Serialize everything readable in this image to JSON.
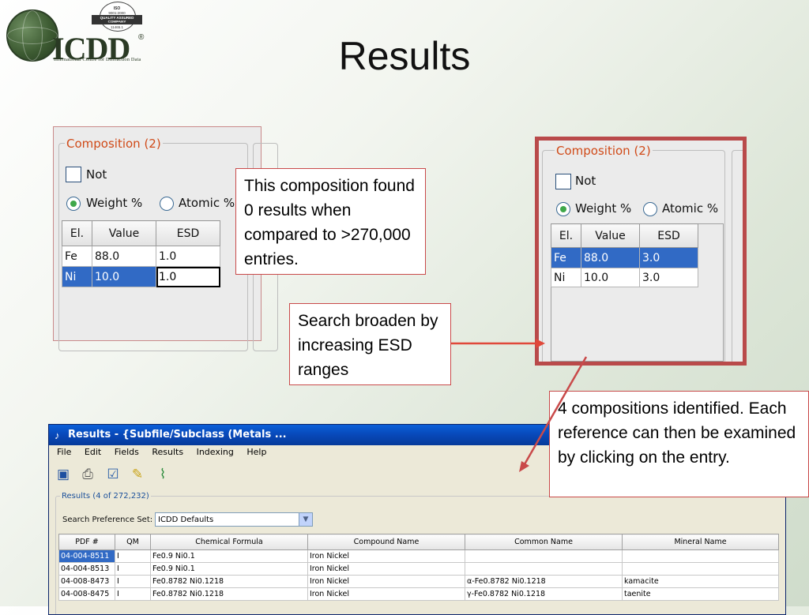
{
  "slide": {
    "title": "Results"
  },
  "logo": {
    "name": "ICDD",
    "registered": "®",
    "subtitle": "International Centre for Diffraction Data",
    "seal": {
      "iso": "ISO",
      "year": "9001:2000",
      "band": "QUALITY ASSURED COMPANY",
      "cert": "CERTIFIED",
      "number": "11465.1"
    }
  },
  "panel_left": {
    "legend": "Composition (2)",
    "not_label": "Not",
    "weight_label": "Weight %",
    "atomic_label": "Atomic %",
    "headers": [
      "El.",
      "Value",
      "ESD"
    ],
    "rows": [
      {
        "el": "Fe",
        "value": "88.0",
        "esd": "1.0"
      },
      {
        "el": "Ni",
        "value": "10.0",
        "esd": "1.0"
      }
    ]
  },
  "panel_right": {
    "legend": "Composition (2)",
    "not_label": "Not",
    "weight_label": "Weight %",
    "atomic_label": "Atomic %",
    "headers": [
      "El.",
      "Value",
      "ESD"
    ],
    "rows": [
      {
        "el": "Fe",
        "value": "88.0",
        "esd": "3.0"
      },
      {
        "el": "Ni",
        "value": "10.0",
        "esd": "3.0"
      }
    ]
  },
  "callouts": {
    "zero_results": "This composition found 0 results when compared to >270,000 entries.",
    "broaden": "Search broaden by increasing ESD ranges",
    "identified": "4 compositions identified. Each reference can then be examined by clicking on the entry."
  },
  "results_window": {
    "title": "Results - {Subfile/Subclass (Metals ...",
    "menu": [
      "File",
      "Edit",
      "Fields",
      "Results",
      "Indexing",
      "Help"
    ],
    "toolbar_icons": [
      "save-icon",
      "print-icon",
      "checklist-icon",
      "notes-icon",
      "graph-icon"
    ],
    "results_label": "Results (4 of 272,232)",
    "preference_label": "Search Preference Set:",
    "preference_value": "ICDD Defaults",
    "columns": [
      "PDF #",
      "QM",
      "Chemical Formula",
      "Compound Name",
      "Common Name",
      "Mineral Name"
    ],
    "rows": [
      [
        "04-004-8511",
        "I",
        "Fe0.9 Ni0.1",
        "Iron Nickel",
        "",
        ""
      ],
      [
        "04-004-8513",
        "I",
        "Fe0.9 Ni0.1",
        "Iron Nickel",
        "",
        ""
      ],
      [
        "04-008-8473",
        "I",
        "Fe0.8782 Ni0.1218",
        "Iron Nickel",
        "α-Fe0.8782 Ni0.1218",
        "kamacite"
      ],
      [
        "04-008-8475",
        "I",
        "Fe0.8782 Ni0.1218",
        "Iron Nickel",
        "γ-Fe0.8782 Ni0.1218",
        "taenite"
      ]
    ]
  },
  "colors": {
    "accent_red": "#c94a4a",
    "legend_orange": "#d04a18",
    "selection_blue": "#316ac5",
    "highlight_frame": "#b94a4a"
  }
}
